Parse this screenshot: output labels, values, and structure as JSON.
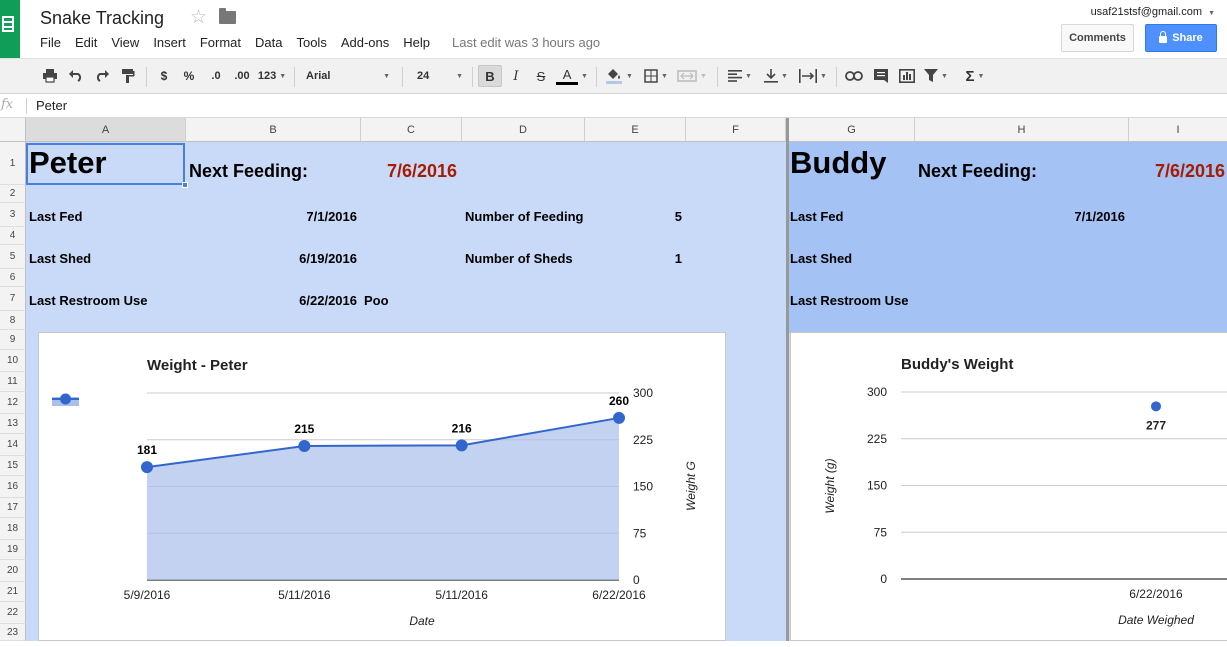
{
  "app": {
    "doc_title": "Snake Tracking",
    "menus": [
      "File",
      "Edit",
      "View",
      "Insert",
      "Format",
      "Data",
      "Tools",
      "Add-ons",
      "Help"
    ],
    "last_edit": "Last edit was 3 hours ago",
    "account": "usaf21stsf@gmail.com",
    "comments_label": "Comments",
    "share_label": "Share",
    "icons": [
      "sheets-logo-icon",
      "star-icon",
      "folder-icon",
      "lock-icon",
      "account-dropdown-icon"
    ]
  },
  "toolbar": {
    "currency": "$",
    "percent": "%",
    "dec_less": ".0",
    "dec_more": ".00",
    "more_formats": "123",
    "font": "Arial",
    "font_size": "24",
    "bold": "B",
    "italic": "I",
    "strike": "S",
    "text_color": "A",
    "icons": [
      "print-icon",
      "undo-icon",
      "redo-icon",
      "paint-format-icon",
      "fill-color-icon",
      "borders-icon",
      "merge-icon",
      "align-left-icon",
      "valign-bottom-icon",
      "wrap-icon",
      "link-icon",
      "comment-icon",
      "chart-icon",
      "filter-icon",
      "sigma-icon"
    ]
  },
  "formula_bar": {
    "fx": "fx",
    "value": "Peter"
  },
  "grid": {
    "columns": [
      "A",
      "B",
      "C",
      "D",
      "E",
      "F",
      "G",
      "H",
      "I"
    ],
    "rows": [
      "1",
      "2",
      "3",
      "4",
      "5",
      "6",
      "7",
      "8",
      "9",
      "10",
      "11",
      "12",
      "13",
      "14",
      "15",
      "16",
      "17",
      "18",
      "19",
      "20",
      "21",
      "22",
      "23"
    ]
  },
  "peter": {
    "name": "Peter",
    "next_feeding_label": "Next Feeding:",
    "next_feeding_date": "7/6/2016",
    "last_fed_label": "Last Fed",
    "last_fed": "7/1/2016",
    "num_feeding_label": "Number of Feeding",
    "num_feeding": "5",
    "last_shed_label": "Last Shed",
    "last_shed": "6/19/2016",
    "num_sheds_label": "Number of Sheds",
    "num_sheds": "1",
    "last_restroom_label": "Last Restroom Use",
    "last_restroom": "6/22/2016",
    "restroom_type": "Poo"
  },
  "buddy": {
    "name": "Buddy",
    "next_feeding_label": "Next Feeding:",
    "next_feeding_date": "7/6/2016",
    "last_fed_label": "Last Fed",
    "last_fed": "7/1/2016",
    "last_shed_label": "Last Shed",
    "last_restroom_label": "Last Restroom Use"
  },
  "colors": {
    "panel_light": "#c9daf8",
    "panel_header": "#a4c2f4",
    "accent_red": "#a61c00",
    "series_blue": "#3366cc",
    "share_blue": "#4d90fe",
    "sheets_green": "#0f9d58"
  },
  "chart_data": [
    {
      "type": "area",
      "title": "Weight - Peter",
      "xlabel": "Date",
      "ylabel": "Weight G",
      "categories": [
        "5/9/2016",
        "5/11/2016",
        "5/11/2016",
        "6/22/2016"
      ],
      "values": [
        181,
        215,
        216,
        260
      ],
      "ylim": [
        0,
        300
      ],
      "yticks": [
        0,
        75,
        150,
        225,
        300
      ],
      "grid": true,
      "y_axis_side": "right",
      "data_labels": true
    },
    {
      "type": "scatter",
      "title": "Buddy's Weight",
      "xlabel": "Date Weighed",
      "ylabel": "Weight (g)",
      "categories": [
        "6/22/2016"
      ],
      "values": [
        277
      ],
      "ylim": [
        0,
        300
      ],
      "yticks": [
        0,
        75,
        150,
        225,
        300
      ],
      "grid": true,
      "y_axis_side": "left",
      "data_labels": true
    }
  ]
}
